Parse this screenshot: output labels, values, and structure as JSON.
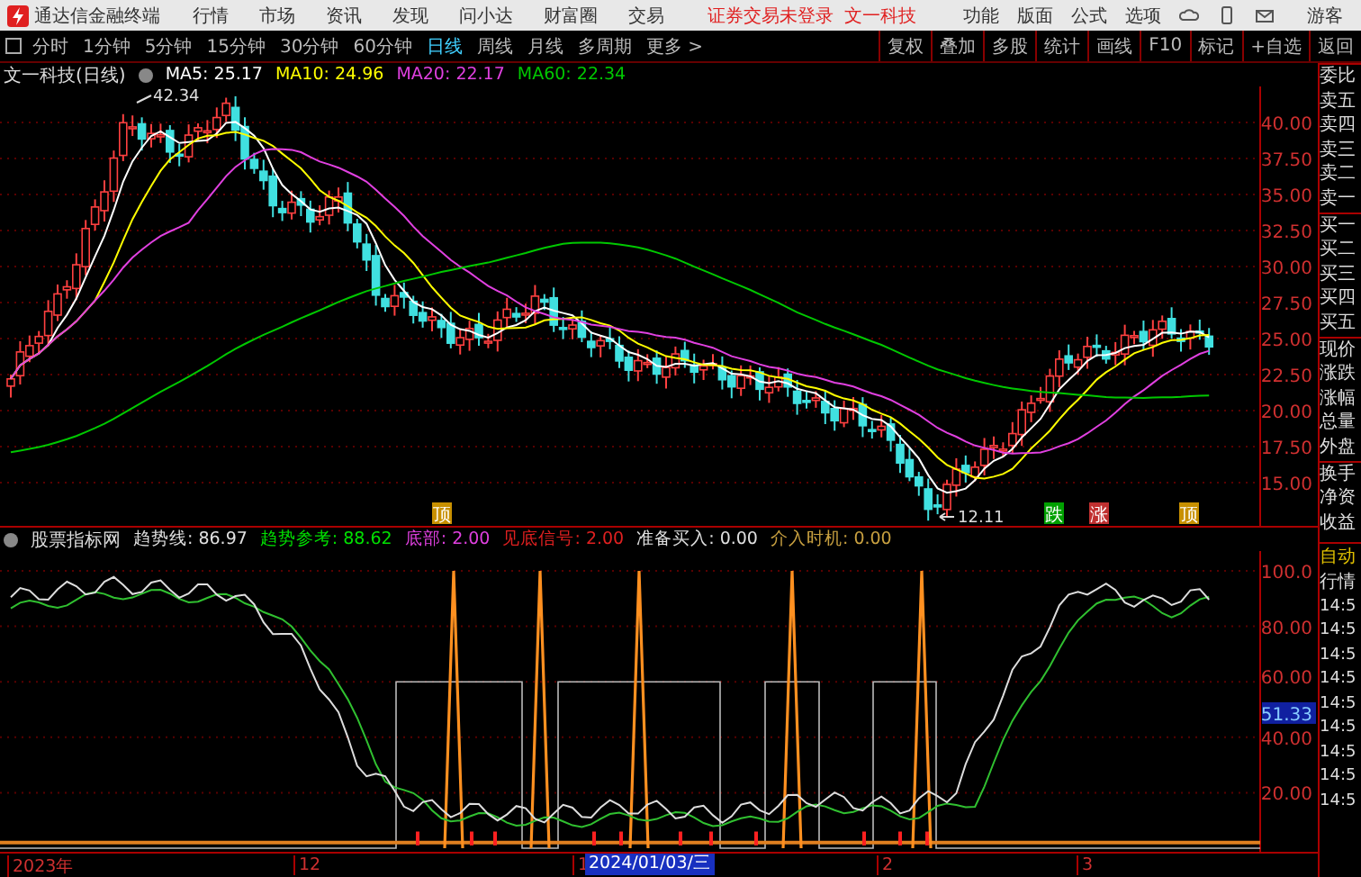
{
  "app_bar": {
    "app_name": "通达信金融终端",
    "menus": [
      "行情",
      "市场",
      "资讯",
      "发现",
      "问小达",
      "财富圈",
      "交易"
    ],
    "login_notice": "证券交易未登录",
    "stock_name": "文一科技",
    "right_menus": [
      "功能",
      "版面",
      "公式",
      "选项"
    ],
    "user": "游客"
  },
  "period_tabs": [
    {
      "label": "分时",
      "selected": false
    },
    {
      "label": "1分钟",
      "selected": false
    },
    {
      "label": "5分钟",
      "selected": false
    },
    {
      "label": "15分钟",
      "selected": false
    },
    {
      "label": "30分钟",
      "selected": false
    },
    {
      "label": "60分钟",
      "selected": false
    },
    {
      "label": "日线",
      "selected": true
    },
    {
      "label": "周线",
      "selected": false
    },
    {
      "label": "月线",
      "selected": false
    },
    {
      "label": "多周期",
      "selected": false
    },
    {
      "label": "更多 >",
      "selected": false
    }
  ],
  "tools": [
    "复权",
    "叠加",
    "多股",
    "统计",
    "画线",
    "F10",
    "标记",
    "+自选",
    "返回"
  ],
  "price_pane": {
    "title": "文一科技(日线)",
    "averages": [
      {
        "label": "MA5: 25.17",
        "color": "#ffffff"
      },
      {
        "label": "MA10: 24.96",
        "color": "#ffff00"
      },
      {
        "label": "MA20: 22.17",
        "color": "#e040e0"
      },
      {
        "label": "MA60: 22.34",
        "color": "#00c800"
      }
    ],
    "axis_labels": [
      "40.00",
      "37.50",
      "35.00",
      "32.50",
      "30.00",
      "27.50",
      "25.00",
      "22.50",
      "20.00",
      "17.50",
      "15.00"
    ],
    "high_label": "42.34",
    "low_label": "12.11",
    "signals": [
      {
        "label": "顶",
        "color": "#c89000"
      },
      {
        "label": "跌",
        "color": "#00a000"
      },
      {
        "label": "涨",
        "color": "#c03030"
      },
      {
        "label": "顶",
        "color": "#c89000"
      }
    ]
  },
  "indicator_pane": {
    "name": "股票指标网",
    "values": [
      {
        "label": "趋势线: 86.97",
        "color": "#e0e0e0"
      },
      {
        "label": "趋势参考: 88.62",
        "color": "#00e000"
      },
      {
        "label": "底部: 2.00",
        "color": "#e040e0"
      },
      {
        "label": "见底信号: 2.00",
        "color": "#e02020"
      },
      {
        "label": "准备买入: 0.00",
        "color": "#e0e0e0"
      },
      {
        "label": "介入时机: 0.00",
        "color": "#c8a040"
      }
    ],
    "axis_labels": [
      "100.0",
      "80.00",
      "60.00",
      "40.00",
      "20.00"
    ],
    "current_value": "51.33"
  },
  "time_axis": [
    "2023年",
    "12",
    "1",
    "2",
    "3"
  ],
  "cursor_date": "2024/01/03/三",
  "quote_panel": {
    "labels": [
      "委比",
      "卖五",
      "卖四",
      "卖三",
      "卖二",
      "卖一",
      "买一",
      "买二",
      "买三",
      "买四",
      "买五",
      "现价",
      "涨跌",
      "涨幅",
      "总量",
      "外盘",
      "换手",
      "净资",
      "收益"
    ],
    "auto_label": "自动",
    "trades_label": "行情",
    "times": [
      "14:5",
      "14:5",
      "14:5",
      "14:5",
      "14:5",
      "14:5",
      "14:5",
      "14:5",
      "14:5"
    ]
  }
}
